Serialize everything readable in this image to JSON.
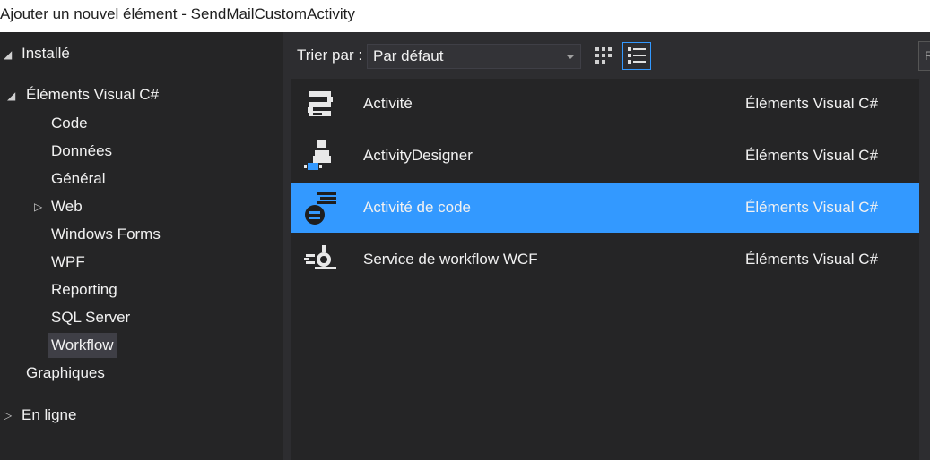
{
  "window": {
    "title": "Ajouter un nouvel élément - SendMailCustomActivity"
  },
  "tree": {
    "installed": "Installé",
    "visual_csharp": "Éléments Visual C#",
    "children": [
      "Code",
      "Données",
      "Général",
      "Web",
      "Windows Forms",
      "WPF",
      "Reporting",
      "SQL Server",
      "Workflow"
    ],
    "graphics": "Graphiques",
    "online": "En ligne",
    "selected": "Workflow"
  },
  "toolbar": {
    "sort_label": "Trier par :",
    "sort_value": "Par défaut"
  },
  "items": [
    {
      "name": "Activité",
      "category": "Éléments Visual C#",
      "icon": "activity-icon"
    },
    {
      "name": "ActivityDesigner",
      "category": "Éléments Visual C#",
      "icon": "activity-designer-icon"
    },
    {
      "name": "Activité de code",
      "category": "Éléments Visual C#",
      "icon": "code-activity-icon",
      "selected": true
    },
    {
      "name": "Service de workflow WCF",
      "category": "Éléments Visual C#",
      "icon": "wcf-workflow-icon"
    }
  ],
  "colors": {
    "selection": "#3399ff",
    "background": "#2d2d30",
    "panel": "#252526"
  }
}
